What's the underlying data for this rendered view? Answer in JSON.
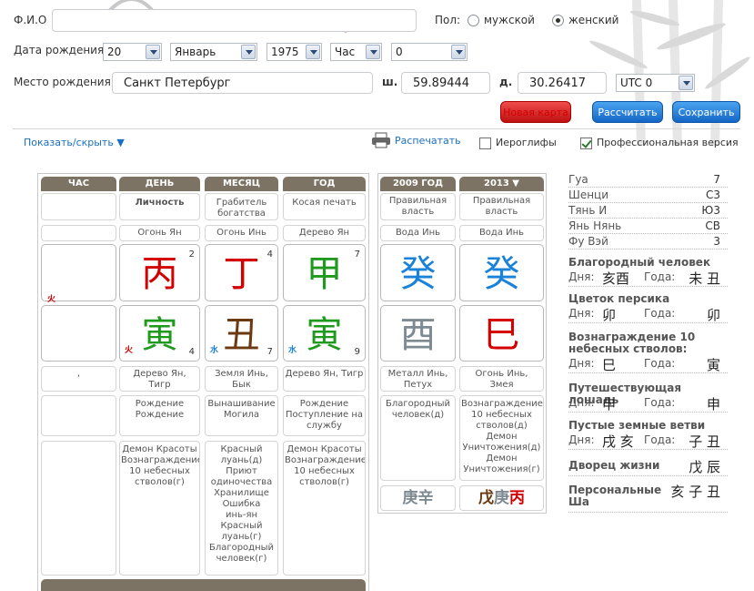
{
  "form": {
    "fio_label": "Ф.И.О",
    "fio_value": "",
    "gender_label": "Пол:",
    "gender_male": "мужской",
    "gender_female": "женский",
    "birth_label": "Дата рождения",
    "day": "20",
    "month": "Январь",
    "year": "1975",
    "hour": "Час",
    "minute": "0",
    "place_label": "Место рождения",
    "place_value": "Санкт Петербург",
    "lat_label": "ш.",
    "lat_value": "59.89444",
    "lon_label": "д.",
    "lon_value": "30.26417",
    "utc": "UTC 0",
    "new_card": "Новая карта",
    "calculate": "Рассчитать",
    "save": "Сохранить"
  },
  "toolbar": {
    "toggle": "Показать/скрыть ▼",
    "print": "Распечатать",
    "hieroglyphs": "Иероглифы",
    "pro": "Профессиональная версия"
  },
  "pillars": [
    {
      "header": "ЧАС",
      "star": "",
      "element": "",
      "stem": "",
      "stem_num": "",
      "branch": "",
      "branch_num": "",
      "branch_el": "",
      "hidden": ",",
      "state": "",
      "extra": ""
    },
    {
      "header": "ДЕНЬ",
      "star": "Личность",
      "element": "Огонь Ян",
      "stem": "丙",
      "stem_num": "2",
      "branch": "寅",
      "branch_num": "4",
      "branch_el": "火",
      "hidden": "Дерево Ян, Тигр",
      "state": "Рождение\nРождение",
      "extra": "Демон Красоты\nВознаграждение\n10 небесных\nстволов(г)"
    },
    {
      "header": "МЕСЯЦ",
      "star": "Грабитель\nбогатства",
      "element": "Огонь Инь",
      "stem": "丁",
      "stem_num": "4",
      "branch": "丑",
      "branch_num": "7",
      "branch_el": "水",
      "hidden": "Земля Инь,\nБык",
      "state": "Вынашивание\nМогила",
      "extra": "Красный\nлуань(д)\nПриют\nодиночества\nХранилище\nОшибка\nинь-ян\nКрасный\nлуань(г)\nБлагородный\nчеловек(г)"
    },
    {
      "header": "ГОД",
      "star": "Косая печать",
      "element": "Дерево Ян",
      "stem": "甲",
      "stem_num": "7",
      "branch": "寅",
      "branch_num": "9",
      "branch_el": "水",
      "hidden": "Дерево Ян, Тигр",
      "state": "Рождение\nПоступление на\nслужбу",
      "extra": "Демон Красоты\nВознаграждение\n10 небесных\nстволов(г)"
    }
  ],
  "hour_cell_marker": "火",
  "luck": [
    {
      "header": "2009 ГОД",
      "star": "Правильная\nвласть",
      "element": "Вода Инь",
      "stem": "癸",
      "branch": "酉",
      "hidden": "Металл Инь,\nПетух",
      "extra": "Благородный\nчеловек(д)",
      "bottom": "庚辛"
    },
    {
      "header": "2013 ▼",
      "star": "Правильная\nвласть",
      "element": "Вода Инь",
      "stem": "癸",
      "branch": "巳",
      "hidden": "Огонь Инь,\nЗмея",
      "extra": "Вознаграждение\n10 небесных\nстволов(д)\nДемон\nУничтожения(д)\nДемон\nУничтожения(г)",
      "bottom_a": "戊",
      "bottom_b": "庚",
      "bottom_c": "丙"
    }
  ],
  "right": {
    "params": [
      [
        "Гуа",
        "7"
      ],
      [
        "Шенци",
        "С3"
      ],
      [
        "Тянь И",
        "Ю3"
      ],
      [
        "Янь Нянь",
        "СВ"
      ],
      [
        "Фу Вэй",
        "3"
      ]
    ],
    "noble": {
      "title": "Благородный человек",
      "day_lbl": "Дня:",
      "day": "亥酉",
      "year_lbl": "Года:",
      "year": "未 丑"
    },
    "peach": {
      "title": "Цветок персика",
      "day_lbl": "Дня:",
      "day": "卯",
      "year_lbl": "Года:",
      "year": "卯"
    },
    "reward": {
      "title": "Вознаграждение 10 небесных стволов:",
      "day_lbl": "Дня:",
      "day": "巳",
      "year_lbl": "Года:",
      "year": "寅"
    },
    "horse": {
      "title": "Путешествующая лошадь",
      "day_lbl": "Дня:",
      "day": "申",
      "year_lbl": "Года:",
      "year": "申"
    },
    "empty": {
      "title": "Пустые земные ветви",
      "day_lbl": "Дня:",
      "day": "戌 亥",
      "year_lbl": "Года:",
      "year": "子 丑"
    },
    "palace": {
      "title": "Дворец жизни",
      "value": "戊 辰"
    },
    "personal": {
      "title": "Персональные Ша",
      "value": "亥 子 丑"
    }
  }
}
